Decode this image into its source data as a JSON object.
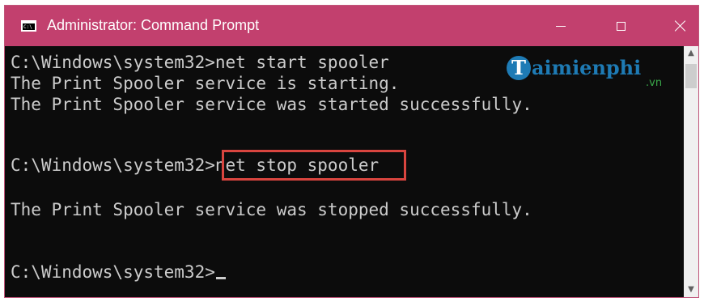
{
  "window": {
    "title": "Administrator: Command Prompt",
    "app_icon": "cmd-icon",
    "app_icon_text": "C:\\",
    "controls": [
      "minimize-icon",
      "maximize-icon",
      "close-icon"
    ]
  },
  "console": {
    "lines": [
      "C:\\Windows\\system32>net start spooler",
      "The Print Spooler service is starting.",
      "The Print Spooler service was started successfully.",
      "C:\\Windows\\system32>net stop spooler",
      "The Print Spooler service was stopped successfully.",
      "C:\\Windows\\system32>"
    ],
    "highlighted_command": "net stop spooler"
  },
  "watermark": {
    "logo_letter": "T",
    "text": "aimienphi",
    "suffix": ".vn"
  },
  "scrollbar": {
    "up_icon": "chevron-up-icon",
    "down_icon": "chevron-down-icon"
  },
  "colors": {
    "titlebar": "#c2406e",
    "console_bg": "#0c0c0c",
    "console_text": "#cccccc",
    "highlight_box": "#d9453f",
    "watermark_blue": "#1e7bb5",
    "watermark_green": "#3aa84a"
  }
}
